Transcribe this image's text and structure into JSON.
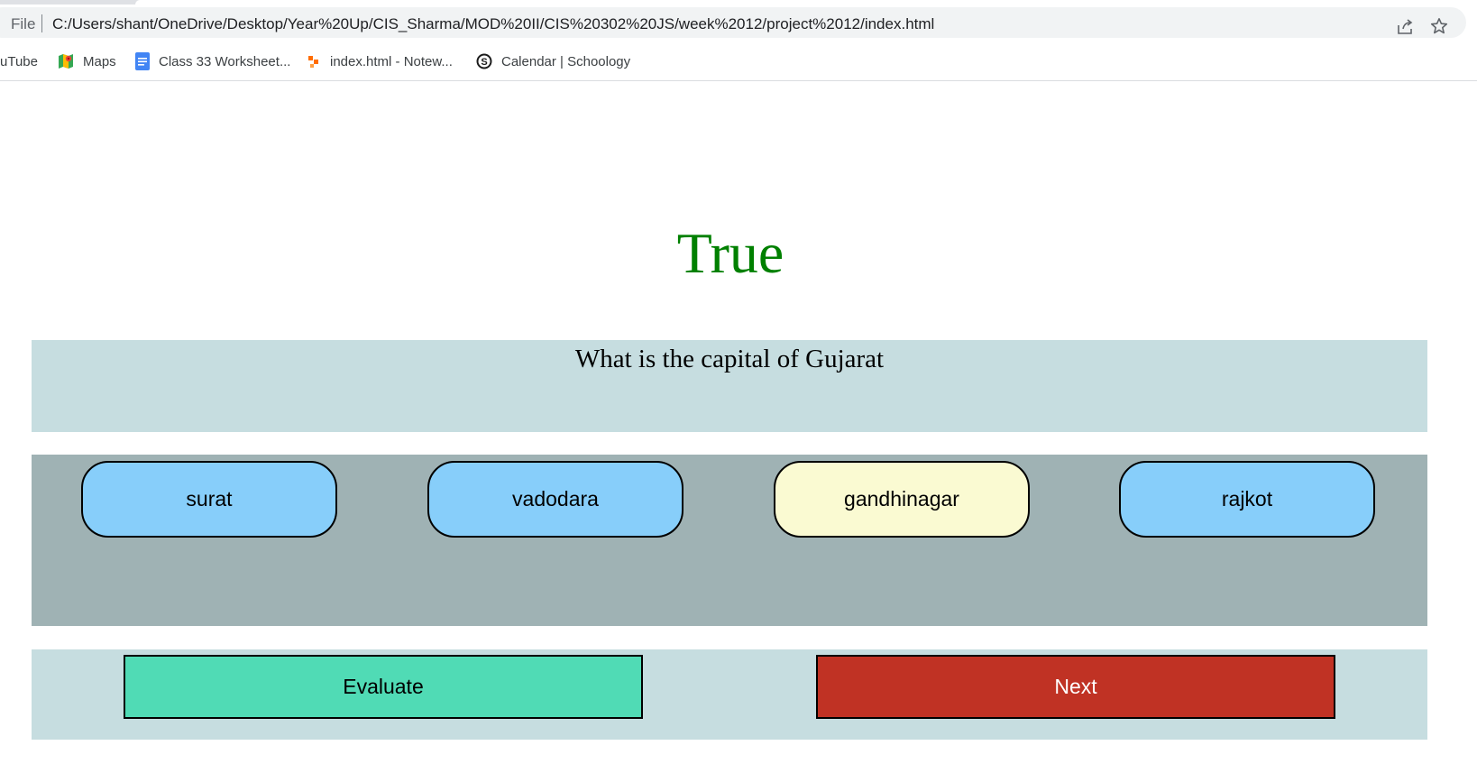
{
  "browser": {
    "scheme": "File",
    "url": "C:/Users/shant/OneDrive/Desktop/Year%20Up/CIS_Sharma/MOD%20II/CIS%20302%20JS/week%2012/project%2012/index.html",
    "icons": [
      "info-icon",
      "share-icon",
      "star-icon"
    ]
  },
  "bookmarks": [
    {
      "label": "uTube",
      "icon": "youtube"
    },
    {
      "label": "Maps",
      "icon": "maps-icon"
    },
    {
      "label": "Class 33 Worksheet...",
      "icon": "docs-icon"
    },
    {
      "label": "index.html - Notew...",
      "icon": "notewise-icon"
    },
    {
      "label": "Calendar | Schoology",
      "icon": "schoology-icon"
    }
  ],
  "quiz": {
    "result": "True",
    "result_color": "#008000",
    "question": "What is the capital of Gujarat",
    "options": [
      {
        "label": "surat",
        "color": "#87cefa"
      },
      {
        "label": "vadodara",
        "color": "#87cefa"
      },
      {
        "label": "gandhinagar",
        "color": "#fafad2"
      },
      {
        "label": "rajkot",
        "color": "#87cefa"
      }
    ],
    "evaluate_label": "Evaluate",
    "evaluate_color": "#50dbb5",
    "next_label": "Next",
    "next_color": "#c03224"
  }
}
